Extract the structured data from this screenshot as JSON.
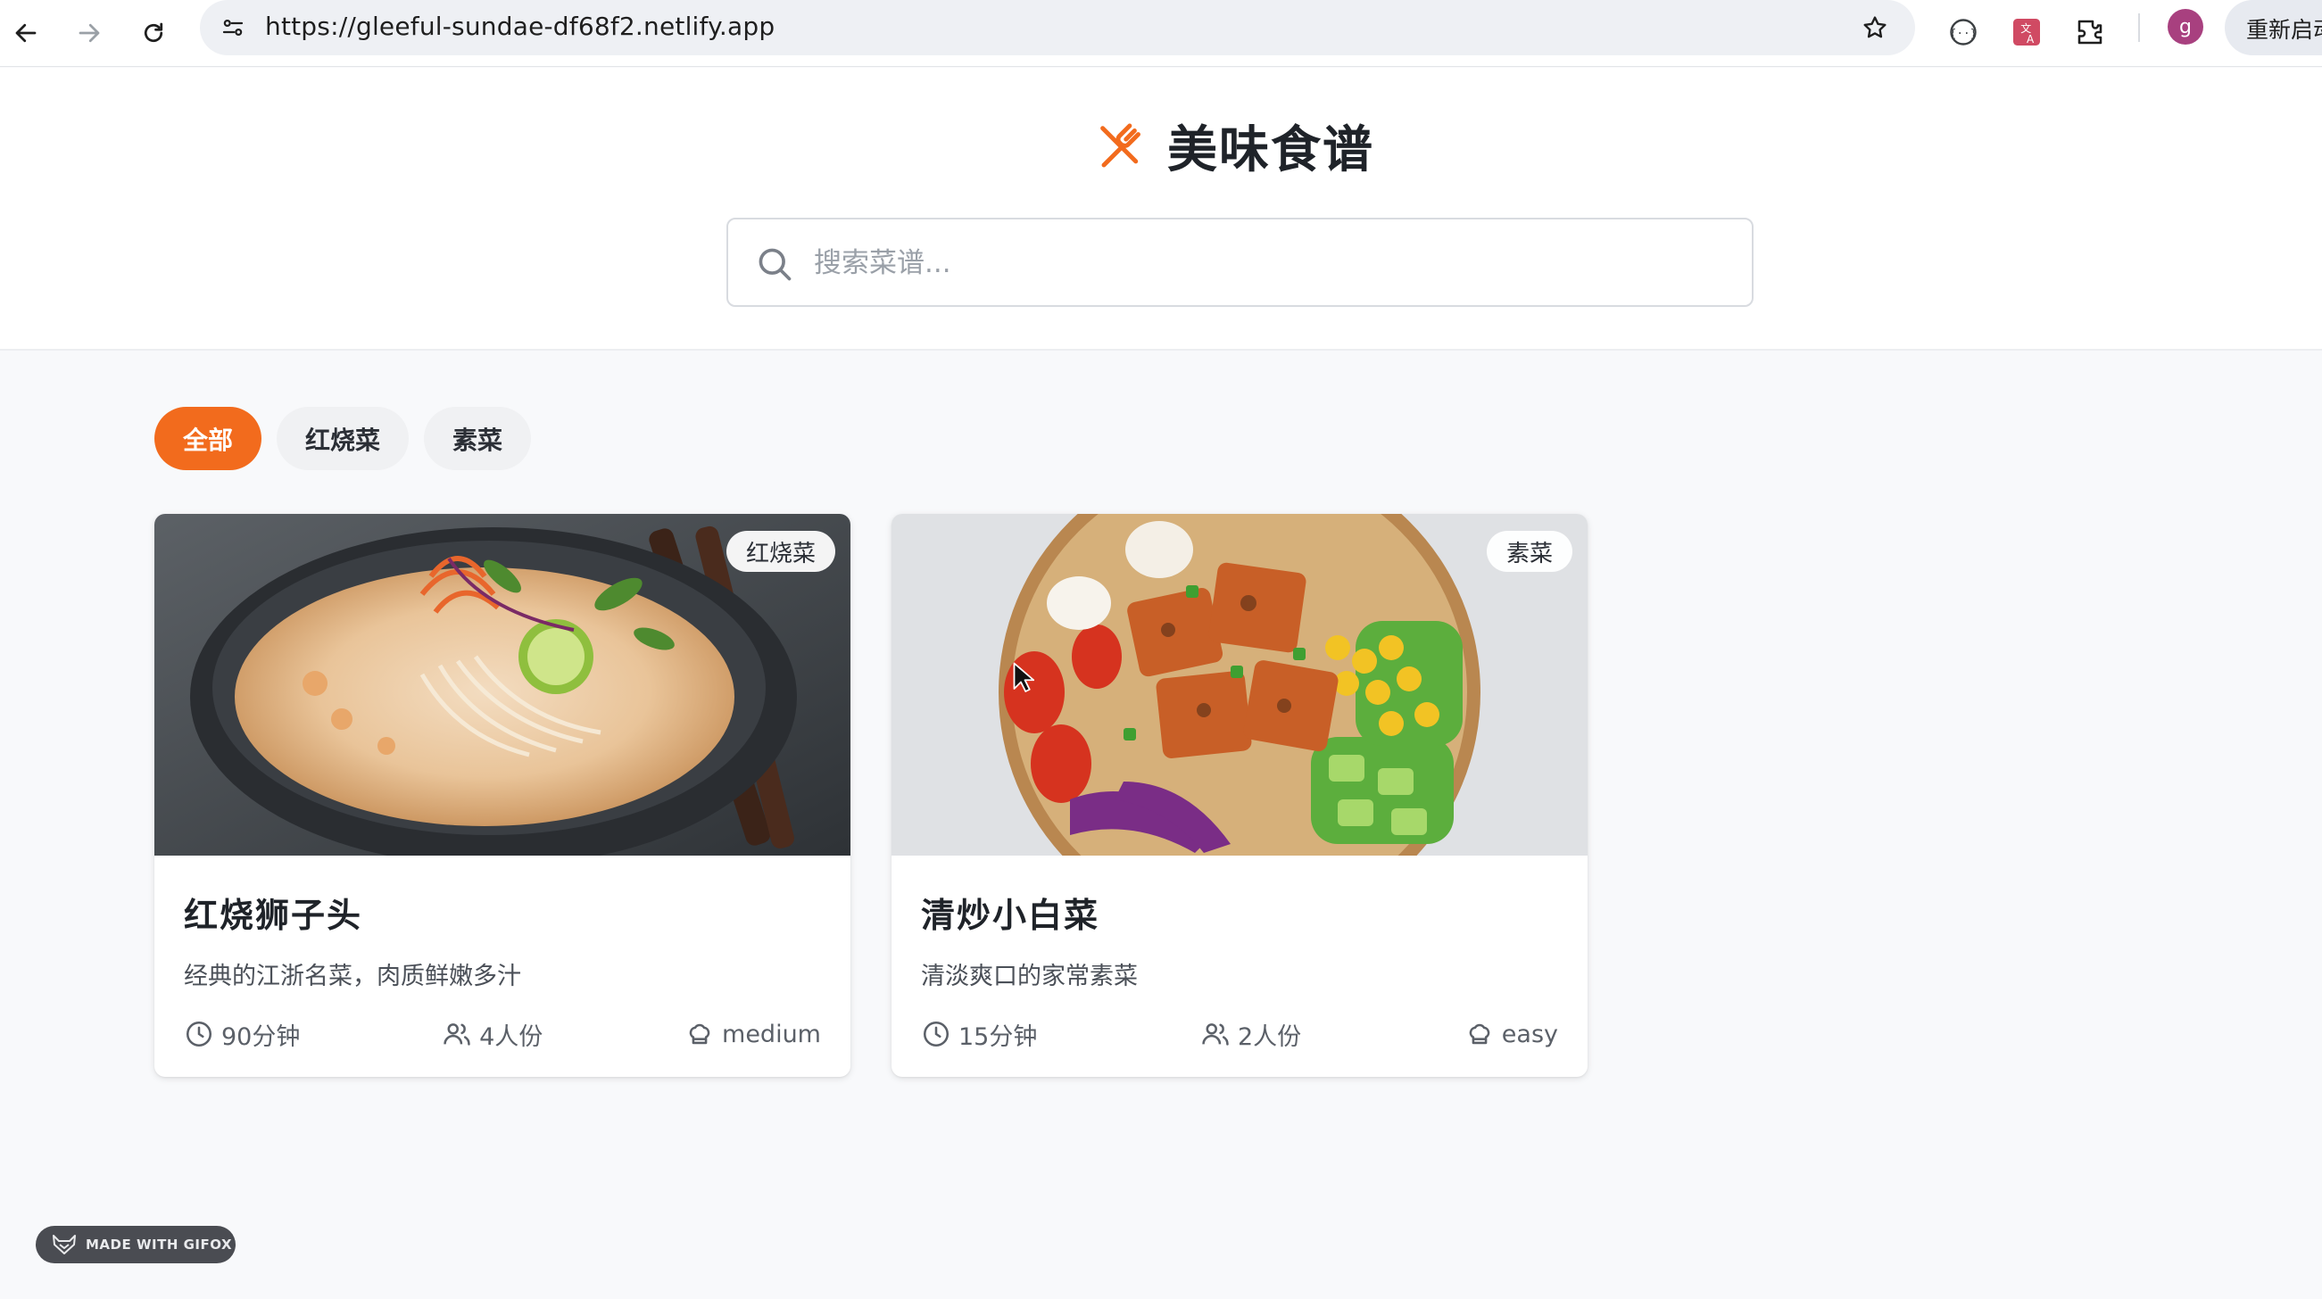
{
  "browser": {
    "url": "https://gleeful-sundae-df68f2.netlify.app",
    "profile_initial": "g",
    "restart_label": "重新启动"
  },
  "header": {
    "brand_title": "美味食谱",
    "search_placeholder": "搜索菜谱..."
  },
  "filters": [
    {
      "label": "全部",
      "active": true
    },
    {
      "label": "红烧菜",
      "active": false
    },
    {
      "label": "素菜",
      "active": false
    }
  ],
  "recipes": [
    {
      "tag": "红烧菜",
      "title": "红烧狮子头",
      "description": "经典的江浙名菜，肉质鲜嫩多汁",
      "time": "90分钟",
      "servings": "4人份",
      "difficulty": "medium"
    },
    {
      "tag": "素菜",
      "title": "清炒小白菜",
      "description": "清淡爽口的家常素菜",
      "time": "15分钟",
      "servings": "2人份",
      "difficulty": "easy"
    }
  ],
  "badge": {
    "text": "MADE WITH GIFOX"
  },
  "colors": {
    "accent": "#f26b1d",
    "background": "#f8f9fb"
  }
}
